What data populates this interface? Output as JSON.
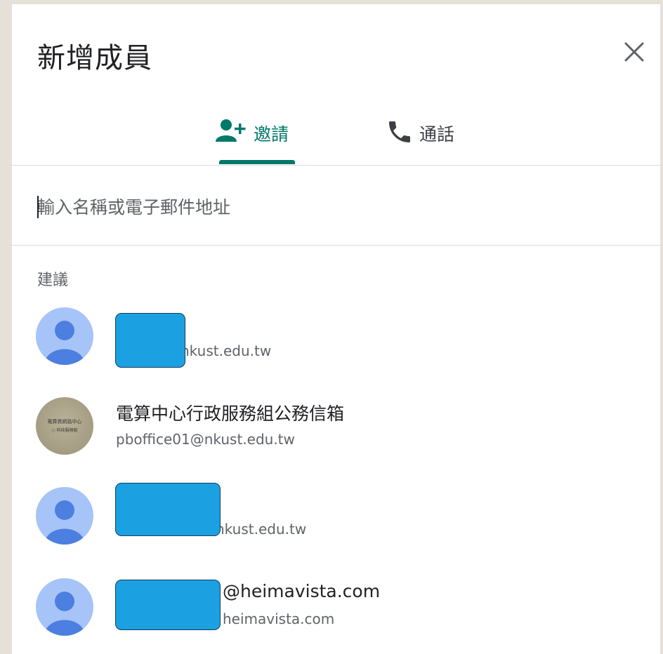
{
  "dialog": {
    "title": "新增成員",
    "close_icon": "close-icon"
  },
  "tabs": [
    {
      "label": "邀請",
      "icon": "add-person-icon",
      "active": true,
      "color": "#00796b"
    },
    {
      "label": "通話",
      "icon": "phone-icon",
      "active": false,
      "color": "#3c4043"
    }
  ],
  "search": {
    "placeholder": "輸入名稱或電子郵件地址",
    "value": ""
  },
  "suggestions": {
    "label": "建議",
    "items": [
      {
        "name": "",
        "email": "nkust.edu.tw",
        "avatar": "default-person-avatar",
        "redacted": true
      },
      {
        "name": "電算中心行政服務組公務信箱",
        "email": "pboffice01@nkust.edu.tw",
        "avatar": "organization-logo-avatar",
        "avatar_text": "電算資網路中心",
        "avatar_subtext": "○ 科技服務組",
        "redacted": false
      },
      {
        "name": "",
        "email": "nkust.edu.tw",
        "avatar": "default-person-avatar",
        "redacted": true
      },
      {
        "name": "@heimavista.com",
        "email": "heimavista.com",
        "avatar": "default-person-avatar",
        "redacted": true
      }
    ]
  },
  "colors": {
    "accent": "#00796b",
    "avatar_bg": "#a6c4f8",
    "avatar_fg": "#4d7fe0",
    "redact": "#1ba1e2"
  }
}
